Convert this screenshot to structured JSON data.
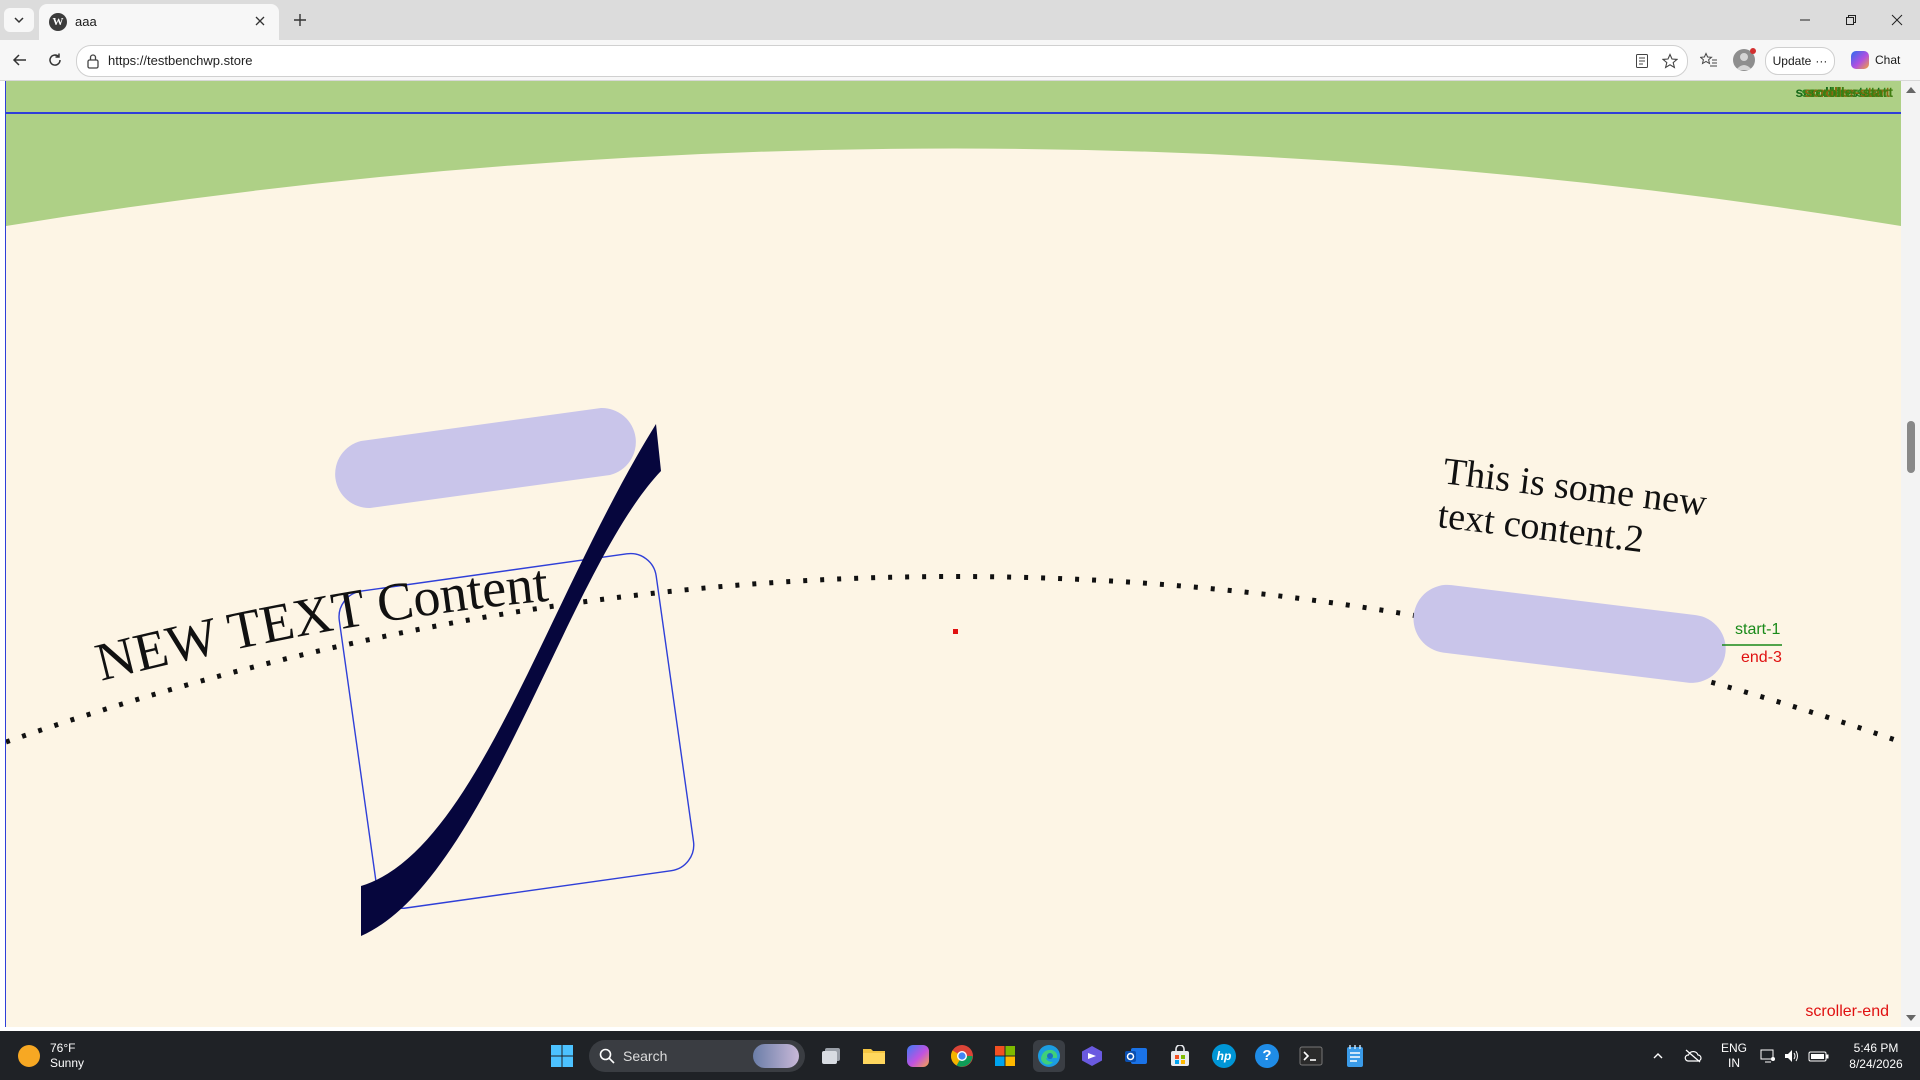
{
  "browser": {
    "tab": {
      "title": "aaa",
      "favicon_icon": "wordpress-icon"
    },
    "address_bar": {
      "url": "https://testbenchwp.store"
    },
    "toolbar": {
      "update_label": "Update",
      "chat_label": "Chat"
    }
  },
  "page": {
    "scroller_labels": [
      "scroller-start",
      "scroller-start",
      "scroller-start",
      "scroller-start"
    ],
    "curved_text": "NEW TEXT Content",
    "rotated_text": "This is some new text content.2",
    "marker_start": "start-1",
    "marker_end": "end-3",
    "scroller_end": "scroller-end",
    "colors": {
      "page_background": "#fdf5e5",
      "top_band": "#aed086",
      "frame_border": "#2f3fd8",
      "pill": "#c9c5ea",
      "swoosh": "#06063d",
      "start_marker": "#1a8a1a",
      "end_marker": "#e01010"
    }
  },
  "taskbar": {
    "weather": {
      "temp": "76°F",
      "condition": "Sunny"
    },
    "search_placeholder": "Search",
    "language": {
      "line1": "ENG",
      "line2": "IN"
    },
    "clock": {
      "time": "5:46 PM",
      "date": "8/24/2026"
    }
  }
}
